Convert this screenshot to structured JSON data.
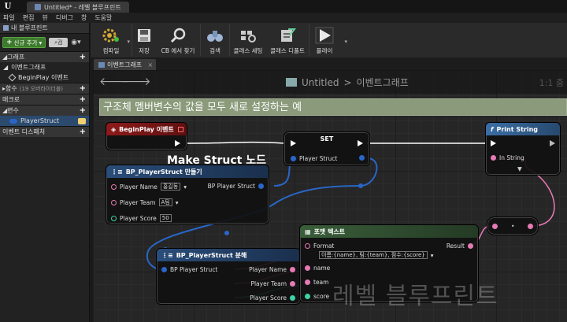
{
  "window": {
    "tab_title": "Untitled* - 레벨 블루프린트"
  },
  "menu": [
    "파일",
    "편집",
    "뷰",
    "디버그",
    "창",
    "도움말"
  ],
  "left_panel": {
    "tab_label": "내 블루프린트",
    "add_button": "신규 추가",
    "search_placeholder": "검",
    "sections": {
      "graph": "그래프",
      "event_graph": "이벤트그래프",
      "begin_play": "BeginPlay 이벤트",
      "functions": "함수",
      "functions_sub": "(19 오버라이더블)",
      "macros": "매크로",
      "variables": "변수",
      "player_struct": "PlayerStruct",
      "event_dispatchers": "이벤트 디스패처"
    }
  },
  "toolbar": {
    "compile": "컴파일",
    "save": "저장",
    "find_cb": "CB 에서 찾기",
    "search": "검색",
    "class_settings": "클래스 세팅",
    "class_defaults": "클래스 디폴트",
    "play": "플레이"
  },
  "graph_tab": {
    "label": "이벤트그래프"
  },
  "graph": {
    "breadcrumb_root": "Untitled",
    "breadcrumb_sep": ">",
    "breadcrumb_leaf": "이벤트그래프",
    "zoom": "1:1 줌",
    "comment": "구조체 멤버변수의 값을 모두 새로 설정하는 예",
    "make_struct_label": "Make Struct 노드",
    "watermark": "레벨 블루프린트"
  },
  "nodes": {
    "begin_play": {
      "title": "BeginPlay 이벤트"
    },
    "set": {
      "title": "SET",
      "pin": "Player Struct"
    },
    "print": {
      "title": "Print String",
      "in_pin": "In String"
    },
    "make_struct": {
      "title": "BP_PlayerStruct 만들기",
      "name_label": "Player Name",
      "name_value": "홍길동",
      "team_label": "Player Team",
      "team_value": "A팀",
      "score_label": "Player Score",
      "score_value": "50",
      "out_pin": "BP Player Struct"
    },
    "break_struct": {
      "title": "BP_PlayerStruct 분해",
      "in_pin": "BP Player Struct",
      "out_name": "Player Name",
      "out_team": "Player Team",
      "out_score": "Player Score"
    },
    "format_text": {
      "title": "포맷 텍스트",
      "format_label": "Format",
      "format_value": "이름:{name}, 팀:{team}, 점수:{score}",
      "result": "Result",
      "pin_name": "name",
      "pin_team": "team",
      "pin_score": "score"
    }
  },
  "colors": {
    "struct_pin": "#2966c8",
    "text_pin": "#e67ab4",
    "int_pin": "#3fd2a6",
    "exec": "#ffffff",
    "event_head": "#8e1a1a",
    "func_head": "#3b6ea5",
    "struct_head": "#2a4d7a"
  }
}
